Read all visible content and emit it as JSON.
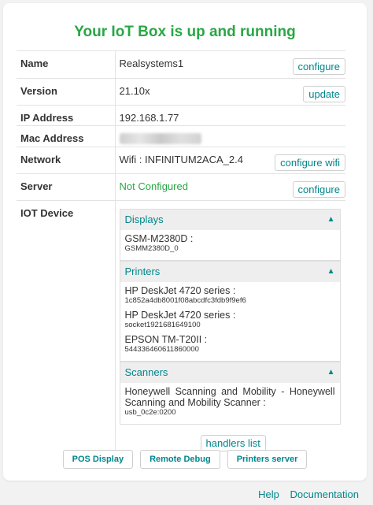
{
  "title": "Your IoT Box is up and running",
  "info": {
    "name": {
      "label": "Name",
      "value": "Realsystems1",
      "button": "configure"
    },
    "version": {
      "label": "Version",
      "value": "21.10x",
      "button": "update"
    },
    "ip": {
      "label": "IP Address",
      "value": "192.168.1.77"
    },
    "mac": {
      "label": "Mac Address"
    },
    "network": {
      "label": "Network",
      "value": "Wifi : INFINITUM2ACA_2.4",
      "button": "configure wifi"
    },
    "server": {
      "label": "Server",
      "value": "Not Configured",
      "button": "configure"
    },
    "iot": {
      "label": "IOT Device"
    }
  },
  "devices": {
    "displays": {
      "title": "Displays",
      "items": [
        {
          "name": "GSM-M2380D :",
          "id": "GSMM2380D_0"
        }
      ]
    },
    "printers": {
      "title": "Printers",
      "items": [
        {
          "name": "HP DeskJet 4720 series :",
          "id": "1c852a4db8001f08abcdfc3fdb9f9ef6"
        },
        {
          "name": "HP DeskJet 4720 series :",
          "id": "socket1921681649100"
        },
        {
          "name": "EPSON TM-T20II :",
          "id": "544336460611860000"
        }
      ]
    },
    "scanners": {
      "title": "Scanners",
      "items": [
        {
          "name": "Honeywell Scanning and Mobility - Honeywell Scanning and Mobility Scanner :",
          "id": "usb_0c2e:0200"
        }
      ]
    },
    "arrow": "▲",
    "handlers_button": "handlers list"
  },
  "bottom": {
    "pos_display": "POS Display",
    "remote_debug": "Remote Debug",
    "printers_server": "Printers server"
  },
  "footer": {
    "help": "Help",
    "documentation": "Documentation"
  },
  "colors": {
    "accent": "#00868b",
    "success": "#28a745"
  }
}
